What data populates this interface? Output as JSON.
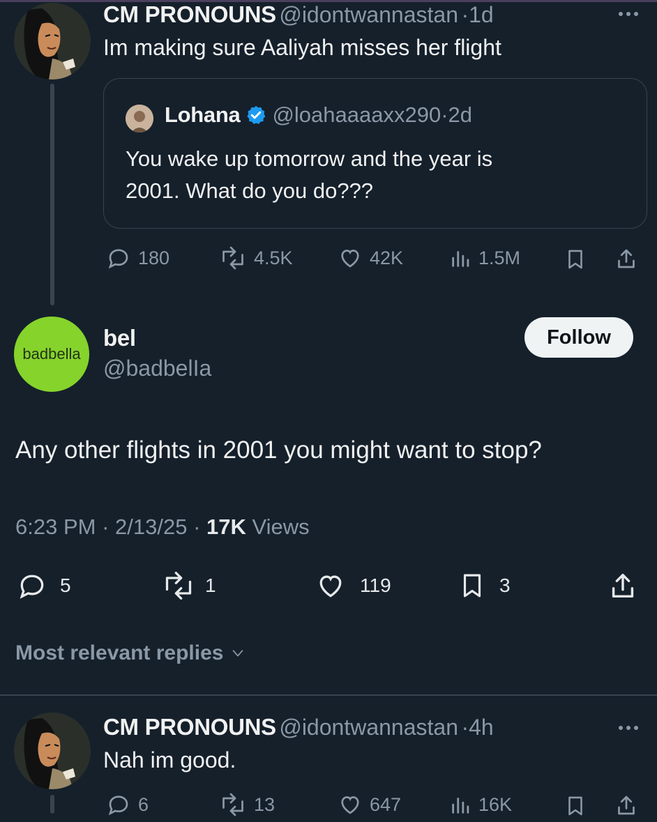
{
  "top_post": {
    "display_name": "CM PRONOUNS",
    "handle": "@idontwannastan",
    "time": "1d",
    "text": "Im making sure Aaliyah misses her flight",
    "quote": {
      "display_name": "Lohana",
      "handle": "@loahaaaaxx290",
      "time": "2d",
      "text_line1": "You wake up tomorrow and the year is",
      "text_line2": "2001. What do you do???"
    },
    "stats": {
      "replies": "180",
      "reposts": "4.5K",
      "likes": "42K",
      "views": "1.5M"
    }
  },
  "main_post": {
    "avatar_text": "badbella",
    "display_name": "bel",
    "handle": "@badbelIa",
    "follow_label": "Follow",
    "text": "Any other flights in 2001 you might want to stop?",
    "meta": {
      "time": "6:23 PM",
      "date": "2/13/25",
      "views_count": "17K",
      "views_label": "Views"
    },
    "stats": {
      "replies": "5",
      "reposts": "1",
      "likes": "119",
      "bookmarks": "3"
    }
  },
  "replies_header": {
    "label": "Most relevant replies"
  },
  "reply_post": {
    "display_name": "CM PRONOUNS",
    "handle": "@idontwannastan",
    "time": "4h",
    "text": "Nah im good.",
    "stats": {
      "replies": "6",
      "reposts": "13",
      "likes": "647",
      "views": "16K"
    }
  },
  "separator": "·",
  "colors": {
    "background": "#15202b",
    "text": "#e7e9ea",
    "muted": "#8b98a5",
    "verified": "#1d9bf0",
    "avatar_green": "#86d32c",
    "border": "#38444d"
  },
  "icons": [
    "more-icon",
    "verified-icon",
    "reply-icon",
    "repost-icon",
    "like-icon",
    "views-icon",
    "bookmark-icon",
    "share-icon",
    "chevron-down-icon"
  ]
}
